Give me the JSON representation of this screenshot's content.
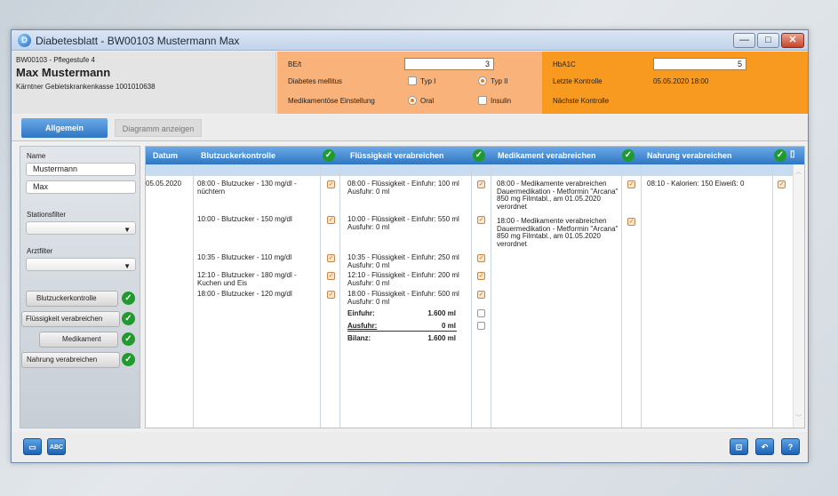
{
  "window": {
    "title": "Diabetesblatt - BW00103 Mustermann Max",
    "app_icon": "D",
    "minimize_label": "—",
    "maximize_label": "□",
    "close_label": "✕"
  },
  "patient": {
    "id_line": "BW00103 - Pflegestufe 4",
    "name": "Max Mustermann",
    "insurance": "Kärntner Gebietskrankenkasse 1001010638"
  },
  "diabetes": {
    "be_label": "BE/t",
    "be_value": "3",
    "mellitus_label": "Diabetes mellitus",
    "typ1_label": "Typ I",
    "typ2_label": "Typ II",
    "medication_label": "Medikamentöse Einstellung",
    "oral_label": "Oral",
    "insulin_label": "Insulin",
    "selected_type": "Typ II",
    "selected_setting": "Oral"
  },
  "control": {
    "hba1c_label": "HbA1C",
    "hba1c_value": "5",
    "last_label": "Letzte Kontrolle",
    "last_value": "05.05.2020 18:00",
    "next_label": "Nächste Kontrolle",
    "next_value": ""
  },
  "tabs": {
    "general": "Allgemein",
    "diagram": "Diagramm anzeigen"
  },
  "sidebar": {
    "name_label": "Name",
    "lastname": "Mustermann",
    "firstname": "Max",
    "station_label": "Stationsfilter",
    "doctor_label": "Arztfilter",
    "buttons": [
      {
        "label": "Blutzuckerkontrolle"
      },
      {
        "label": "Flüssigkeit verabreichen"
      },
      {
        "label": "Medikament"
      },
      {
        "label": "Nahrung verabreichen"
      }
    ]
  },
  "grid": {
    "headers": {
      "date": "Datum",
      "blood": "Blutzuckerkontrolle",
      "fluid": "Flüssigkeit verabreichen",
      "med": "Medikament verabreichen",
      "food": "Nahrung verabreichen"
    },
    "date": "05.05.2020",
    "blood_entries": [
      "08:00 - Blutzucker - 130 mg/dl - nüchtern",
      "10:00 - Blutzucker - 150 mg/dl",
      "10:35 - Blutzucker - 110 mg/dl",
      "12:10 - Blutzucker - 180 mg/dl - Kuchen und Eis",
      "18:00 - Blutzucker - 120 mg/dl"
    ],
    "fluid_entries": [
      "08:00 - Flüssigkeit - Einfuhr: 100 ml Ausfuhr: 0 ml",
      "10:00 - Flüssigkeit - Einfuhr: 550 ml Ausfuhr: 0 ml",
      "10:35 - Flüssigkeit - Einfuhr: 250 ml Ausfuhr: 0 ml",
      "12:10 - Flüssigkeit - Einfuhr: 200 ml Ausfuhr: 0 ml",
      "18:00 - Flüssigkeit - Einfuhr: 500 ml Ausfuhr: 0 ml"
    ],
    "balance": {
      "in_label": "Einfuhr:",
      "in_value": "1.600 ml",
      "out_label": "Ausfuhr:",
      "out_value": "0 ml",
      "sum_label": "Bilanz:",
      "sum_value": "1.600 ml"
    },
    "med_entries": [
      "08:00 - Medikamente verabreichen Dauermedikation - Metformin \"Arcana\" 850 mg Filmtabl., am 01.05.2020 verordnet",
      "18:00 - Medikamente verabreichen Dauermedikation - Metformin \"Arcana\" 850 mg Filmtabl., am 01.05.2020 verordnet"
    ],
    "food_entries": [
      "08:10 - Kalorien: 150 Eiweiß: 0"
    ]
  },
  "footer": {
    "abc_label": "ABC"
  },
  "colors": {
    "header_blue": "#2f76c3",
    "peach": "#f8b27a",
    "orange": "#f89a1f",
    "check_green": "#1f9a2c"
  }
}
